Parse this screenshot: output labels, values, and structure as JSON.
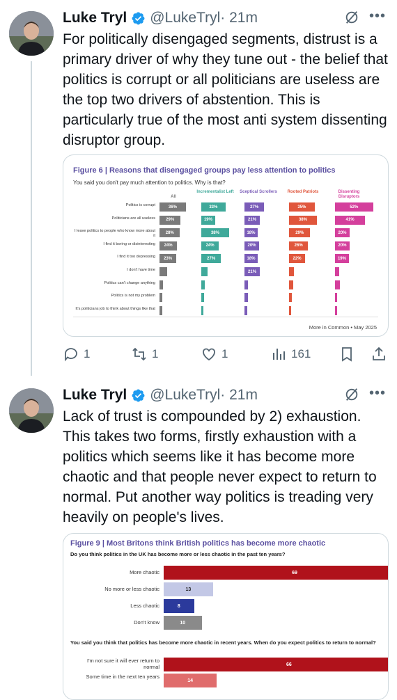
{
  "tweets": [
    {
      "name": "Luke Tryl",
      "handle": "@LukeTryl",
      "time": "· 21m",
      "text": "For politically disengaged segments, distrust is a primary driver of why they tune out - the belief that politics is corrupt or all politicians are useless are the top two drivers of abstention. This is particularly true of the most anti system dissenting disruptor group.",
      "stats": {
        "replies": "1",
        "retweets": "1",
        "likes": "1",
        "views": "161"
      }
    },
    {
      "name": "Luke Tryl",
      "handle": "@LukeTryl",
      "time": "· 21m",
      "text": "Lack of trust is compounded by 2) exhaustion. This takes two forms, firstly exhaustion with a politics which seems like it has become more chaotic and that people never expect to return to normal. Put another way politics is treading very heavily on people's lives."
    }
  ],
  "colors": {
    "verified": "#1d9bf0",
    "figure_title": "#5a4fa0"
  },
  "chart_data": [
    {
      "type": "bar",
      "title": "Figure 6 | Reasons that disengaged groups pay less attention to politics",
      "subtitle": "You said you don't pay much attention to politics. Why is that?",
      "source": "More in Common • May 2025",
      "categories": [
        "Politics is corrupt",
        "Politicians are all useless",
        "I leave politics to people who know more about it",
        "I find it boring or disinteresting",
        "I find it too depressing",
        "I don't have time",
        "Politics can't change anything",
        "Politics is not my problem",
        "It's politicians job to think about things like that"
      ],
      "series": [
        {
          "name": "All",
          "color": "#7a7a7a",
          "values": [
            36,
            29,
            28,
            24,
            23,
            10,
            5,
            4,
            4
          ],
          "labels": [
            "36%",
            "29%",
            "28%",
            "24%",
            "23%",
            "",
            "",
            "",
            ""
          ]
        },
        {
          "name": "Incrementalist Left",
          "color": "#3fa99a",
          "values": [
            33,
            19,
            38,
            24,
            27,
            9,
            5,
            4,
            3
          ],
          "labels": [
            "33%",
            "19%",
            "38%",
            "24%",
            "27%",
            "",
            "",
            "",
            ""
          ]
        },
        {
          "name": "Sceptical Scrollers",
          "color": "#7a5cb8",
          "values": [
            27,
            21,
            18,
            20,
            18,
            21,
            5,
            5,
            4
          ],
          "labels": [
            "27%",
            "21%",
            "18%",
            "20%",
            "18%",
            "21%",
            "",
            "",
            ""
          ]
        },
        {
          "name": "Rooted Patriots",
          "color": "#e0563c",
          "values": [
            35,
            38,
            29,
            26,
            22,
            7,
            6,
            4,
            3
          ],
          "labels": [
            "35%",
            "38%",
            "29%",
            "26%",
            "22%",
            "",
            "",
            "",
            ""
          ]
        },
        {
          "name": "Dissenting Disruptors",
          "color": "#d43f9c",
          "values": [
            52,
            41,
            20,
            20,
            19,
            6,
            7,
            3,
            2
          ],
          "labels": [
            "52%",
            "41%",
            "20%",
            "20%",
            "19%",
            "",
            "",
            "",
            ""
          ]
        }
      ]
    },
    {
      "type": "bar",
      "title": "Figure 9 | Most Britons think British politics has become more chaotic",
      "questions": [
        {
          "text": "Do you think politics in the UK has become more or less chaotic in the past ten years?",
          "categories": [
            "More chaotic",
            "No more or less chaotic",
            "Less chaotic",
            "Don't know"
          ],
          "values": [
            69,
            13,
            8,
            10
          ],
          "colors": [
            "#b0121b",
            "#c3c8e6",
            "#2b3a9c",
            "#8a8a8a"
          ]
        },
        {
          "text": "You said you think that politics has become more chaotic in recent years. When do you expect politics to return to normal?",
          "categories": [
            "I'm not sure it will ever return to normal",
            "Some time in the next ten years"
          ],
          "values": [
            66,
            14
          ],
          "colors": [
            "#b0121b",
            "#e06c6c"
          ]
        }
      ]
    }
  ]
}
